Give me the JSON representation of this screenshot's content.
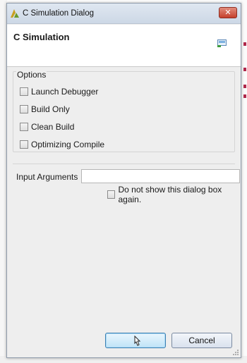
{
  "window": {
    "title": "C Simulation Dialog",
    "close_glyph": "✕"
  },
  "header": {
    "title": "C Simulation",
    "icon": "simulation-banner-icon"
  },
  "options": {
    "group_label": "Options",
    "items": [
      {
        "label": "Launch Debugger",
        "checked": false
      },
      {
        "label": "Build Only",
        "checked": false
      },
      {
        "label": "Clean Build",
        "checked": false
      },
      {
        "label": "Optimizing Compile",
        "checked": false
      }
    ]
  },
  "input_arguments": {
    "label": "Input Arguments",
    "value": ""
  },
  "dont_show": {
    "label": "Do not show this dialog box again.",
    "checked": false
  },
  "buttons": {
    "ok_label": "",
    "cancel_label": "Cancel"
  },
  "colors": {
    "titlebar": "#cdd8e6",
    "close_button": "#c5402c",
    "ok_button_border": "#3c7fb1"
  }
}
